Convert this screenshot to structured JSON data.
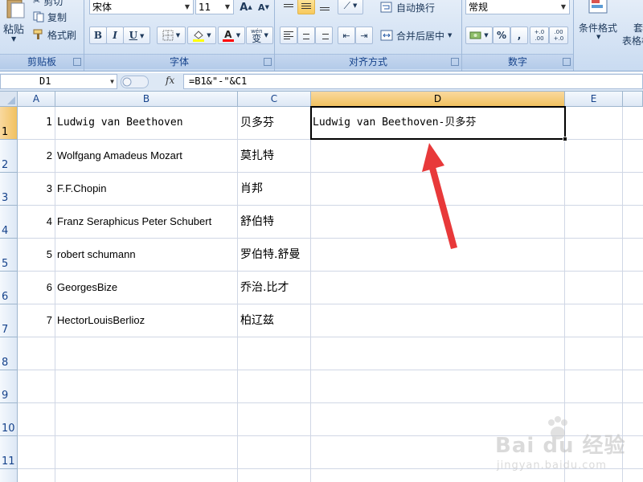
{
  "ribbon": {
    "clipboard": {
      "label": "剪贴板",
      "paste": "粘贴",
      "cut": "剪切",
      "copy": "复制",
      "format_painter": "格式刷"
    },
    "font": {
      "label": "字体",
      "font_name": "宋体",
      "font_size": "11",
      "bold": "B",
      "italic": "I",
      "underline": "U",
      "grow": "A",
      "shrink": "A",
      "font_color": "A",
      "phonetic": "wén",
      "phonetic_char": "变"
    },
    "alignment": {
      "label": "对齐方式",
      "wrap_text": "自动换行",
      "merge_center": "合并后居中"
    },
    "number": {
      "label": "数字",
      "format": "常规",
      "percent": "%",
      "comma": ",",
      "inc_decimal": "+.0 .00",
      "dec_decimal": ".00 +.0"
    },
    "styles": {
      "conditional": "条件格式",
      "table_format_1": "套",
      "table_format_2": "表格格"
    }
  },
  "formula_bar": {
    "name_box": "D1",
    "fx": "fx",
    "formula": "=B1&\"-\"&C1"
  },
  "sheet": {
    "columns": [
      "A",
      "B",
      "C",
      "D",
      "E"
    ],
    "active_column": "D",
    "rows": [
      "1",
      "2",
      "3",
      "4",
      "5",
      "6",
      "7",
      "8",
      "9",
      "10",
      "11"
    ],
    "active_row": "1",
    "data": [
      {
        "a": "1",
        "b": "Ludwig van Beethoven",
        "c": "贝多芬",
        "d": "Ludwig van Beethoven-贝多芬"
      },
      {
        "a": "2",
        "b": "Wolfgang Amadeus Mozart",
        "c": "莫扎特",
        "d": ""
      },
      {
        "a": "3",
        "b": "F.F.Chopin",
        "c": "肖邦",
        "d": ""
      },
      {
        "a": "4",
        "b": "Franz Seraphicus Peter Schubert",
        "c": "舒伯特",
        "d": ""
      },
      {
        "a": "5",
        "b": "robert schumann",
        "c": "罗伯特.舒曼",
        "d": ""
      },
      {
        "a": "6",
        "b": "GeorgesBize",
        "c": "乔治.比才",
        "d": ""
      },
      {
        "a": "7",
        "b": "HectorLouisBerlioz",
        "c": "柏辽兹",
        "d": ""
      }
    ]
  },
  "watermark": {
    "brand": "Bai du 经验",
    "url": "jingyan.baidu.com"
  },
  "colors": {
    "annotation_arrow": "#e8393a",
    "active_header": "#f1c15f",
    "gridline": "#d0d7e5"
  }
}
